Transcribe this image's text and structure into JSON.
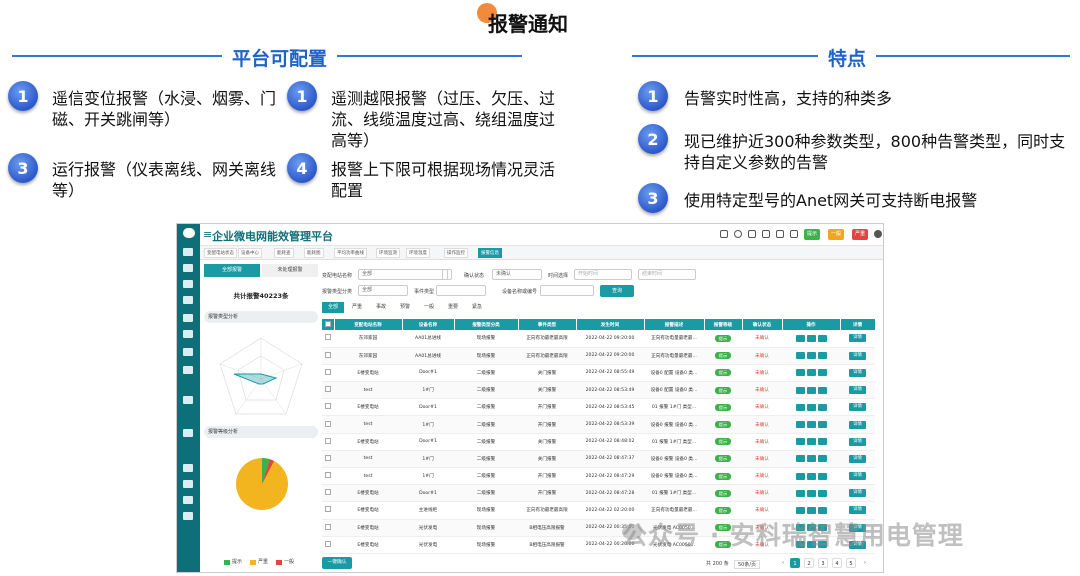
{
  "header": {
    "title": "报警通知"
  },
  "left_section": {
    "title": "平台可配置",
    "items": [
      {
        "num": "1",
        "text": "遥信变位报警（水浸、烟雾、门磁、开关跳闸等）"
      },
      {
        "num": "1",
        "text": "遥测越限报警（过压、欠压、过流、线缆温度过高、绕组温度过高等）"
      },
      {
        "num": "3",
        "text": "运行报警（仪表离线、网关离线等）"
      },
      {
        "num": "4",
        "text": "报警上下限可根据现场情况灵活配置"
      }
    ]
  },
  "right_section": {
    "title": "特点",
    "items": [
      {
        "num": "1",
        "text": "告警实时性高，支持的种类多"
      },
      {
        "num": "2",
        "text": "现已维护近300种参数类型，800种告警类型，同时支持自定义参数的告警"
      },
      {
        "num": "3",
        "text": "使用特定型号的Anet网关可支持断电报警"
      }
    ]
  },
  "app": {
    "title": "企业微电网能效管理平台",
    "badges": [
      {
        "label": "提示",
        "color": "#3db24b"
      },
      {
        "label": "一般",
        "color": "#f2a51f"
      },
      {
        "label": "严重",
        "color": "#e24444"
      }
    ],
    "nav_tabs": [
      "变配电站状态",
      "设备中心",
      "能耗查",
      "能耗图",
      "平均功率曲线",
      "环境监测",
      "环境温度",
      "操作监控",
      "报警信息"
    ],
    "left_panel": {
      "tabs": [
        "全部报警",
        "未处理报警"
      ],
      "total": "共计报警40223条",
      "radar_title": "报警类型分析",
      "pie_title": "报警等级分析",
      "legend": [
        "提示",
        "严重",
        "一般"
      ]
    },
    "filters": {
      "station_label": "变配电站名称",
      "station_value": "全部",
      "confirm_label": "确认状态",
      "confirm_value": "未确认",
      "time_label": "时间选择",
      "start_placeholder": "开始时间",
      "end_placeholder": "结束时间",
      "type_label": "报警类型分类",
      "type_value": "全部",
      "event_label": "事件类型",
      "device_label": "设备名称或编号",
      "search_label": "查询"
    },
    "level_tabs": [
      "全部",
      "严重",
      "事故",
      "预警",
      "一般",
      "重要",
      "紧急"
    ],
    "table": {
      "headers": [
        "",
        "变配电站名称",
        "设备名称",
        "报警类型分类",
        "事件类型",
        "发生时间",
        "报警描述",
        "报警等级",
        "确认状态",
        "操作",
        "详情"
      ],
      "rows": [
        [
          "东郊家园",
          "AA01总进线",
          "现场报警",
          "正向有功最老最高限",
          "2022-04-22 09:20:00",
          "正向有功电量最老最...",
          "提示",
          "未确认",
          "详情"
        ],
        [
          "东郊家园",
          "AA01总进线",
          "现场报警",
          "正向有功最老最高限",
          "2022-04-22 09:20:00",
          "正向有功电量最老最...",
          "提示",
          "未确认",
          "详情"
        ],
        [
          "E楼变电站",
          "Door#1",
          "二级报警",
          "关门报警",
          "2022-04-22 08:55:49",
          "设备0 配置 设备0 类...",
          "提示",
          "未确认",
          "详情"
        ],
        [
          "test",
          "1#门",
          "二级报警",
          "关门报警",
          "2022-04-22 08:53:49",
          "设备0 配置 设备0 类...",
          "提示",
          "未确认",
          "详情"
        ],
        [
          "E楼变电站",
          "Door#1",
          "二级报警",
          "开门报警",
          "2022-04-22 08:53:45",
          "01 报警 1#门 类型...",
          "提示",
          "未确认",
          "详情"
        ],
        [
          "test",
          "1#门",
          "二级报警",
          "开门报警",
          "2022-04-22 08:53:39",
          "设备0 报警 设备0 类...",
          "提示",
          "未确认",
          "详情"
        ],
        [
          "E楼变电站",
          "Door#1",
          "二级报警",
          "关门报警",
          "2022-04-22 08:48:02",
          "01 报警 1#门 类型...",
          "提示",
          "未确认",
          "详情"
        ],
        [
          "test",
          "1#门",
          "二级报警",
          "关门报警",
          "2022-04-22 08:47:37",
          "设备0 报警 设备0 类...",
          "提示",
          "未确认",
          "详情"
        ],
        [
          "test",
          "1#门",
          "二级报警",
          "开门报警",
          "2022-04-22 08:47:29",
          "设备0 报警 设备0 类...",
          "提示",
          "未确认",
          "详情"
        ],
        [
          "E楼变电站",
          "Door#1",
          "二级报警",
          "开门报警",
          "2022-04-22 08:47:28",
          "01 报警 1#门 类型...",
          "提示",
          "未确认",
          "详情"
        ],
        [
          "E楼变电站",
          "主进线柜",
          "现场报警",
          "正向有功最老最高限",
          "2022-04-22 02:20:00",
          "正向有功电量最老最...",
          "提示",
          "未确认",
          "详情"
        ],
        [
          "E楼变电站",
          "光伏发电",
          "现场报警",
          "B相电压高限报警",
          "2022-04-22 00:35:00",
          "光伏发电 AC0050...",
          "提示",
          "未确认",
          "详情"
        ],
        [
          "E楼变电站",
          "光伏发电",
          "现场报警",
          "B相电压高限报警",
          "2022-04-22 00:20:00",
          "光伏发电 AC0050...",
          "提示",
          "未确认",
          "详情"
        ]
      ]
    },
    "batch_confirm": "一键确认",
    "pagination": {
      "total": "共 200 条",
      "page_size": "50条/页",
      "pages": [
        "1",
        "2",
        "3",
        "4",
        "5"
      ]
    }
  },
  "watermark": "公众号 · 安科瑞智慧用电管理"
}
